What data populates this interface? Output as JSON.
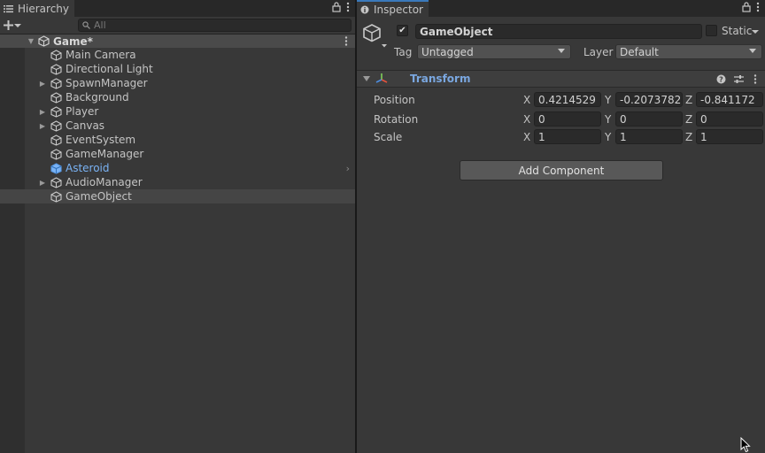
{
  "hierarchy": {
    "tab_label": "Hierarchy",
    "search_placeholder": "All",
    "scene_name": "Game*",
    "items": [
      {
        "label": "Main Camera",
        "expandable": false
      },
      {
        "label": "Directional Light",
        "expandable": false
      },
      {
        "label": "SpawnManager",
        "expandable": true
      },
      {
        "label": "Background",
        "expandable": false
      },
      {
        "label": "Player",
        "expandable": true
      },
      {
        "label": "Canvas",
        "expandable": true
      },
      {
        "label": "EventSystem",
        "expandable": false
      },
      {
        "label": "GameManager",
        "expandable": false
      },
      {
        "label": "Asteroid",
        "expandable": false
      },
      {
        "label": "AudioManager",
        "expandable": true
      },
      {
        "label": "GameObject",
        "expandable": false
      }
    ]
  },
  "inspector": {
    "tab_label": "Inspector",
    "object_name": "GameObject",
    "static_label": "Static",
    "tag_label": "Tag",
    "tag_value": "Untagged",
    "layer_label": "Layer",
    "layer_value": "Default",
    "component_title": "Transform",
    "position_label": "Position",
    "rotation_label": "Rotation",
    "scale_label": "Scale",
    "axis_x": "X",
    "axis_y": "Y",
    "axis_z": "Z",
    "position": {
      "x": "0.4214529",
      "y": "-0.2073782",
      "z": "-0.841172"
    },
    "rotation": {
      "x": "0",
      "y": "0",
      "z": "0"
    },
    "scale": {
      "x": "1",
      "y": "1",
      "z": "1"
    },
    "add_component_label": "Add Component"
  },
  "colors": {
    "prefab_blue": "#7ab3f5",
    "accent": "#3a79bb"
  }
}
